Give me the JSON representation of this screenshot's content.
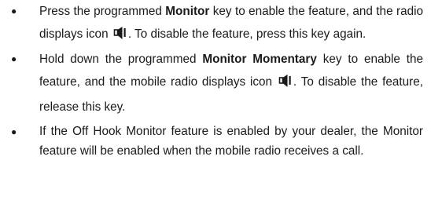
{
  "bullets": [
    {
      "pre": "Press the programmed ",
      "key": "Monitor",
      "mid": " key to enable the feature, and the radio displays icon ",
      "icon": "speaker-icon",
      "post": ". To disable the feature, press this key again."
    },
    {
      "pre": "Hold down the programmed ",
      "key": "Monitor Momentary",
      "mid": " key to enable the feature,  and the mobile radio displays icon ",
      "icon": "speaker-icon",
      "post": ". To disable the feature, release this key."
    },
    {
      "text": "If the Off Hook Monitor feature is enabled by your dealer, the Monitor feature will be enabled when the mobile radio receives a call."
    }
  ],
  "bullet_symbol": "●",
  "colors": {
    "text": "#1a1a1a",
    "icon": "#1a1a1a"
  }
}
